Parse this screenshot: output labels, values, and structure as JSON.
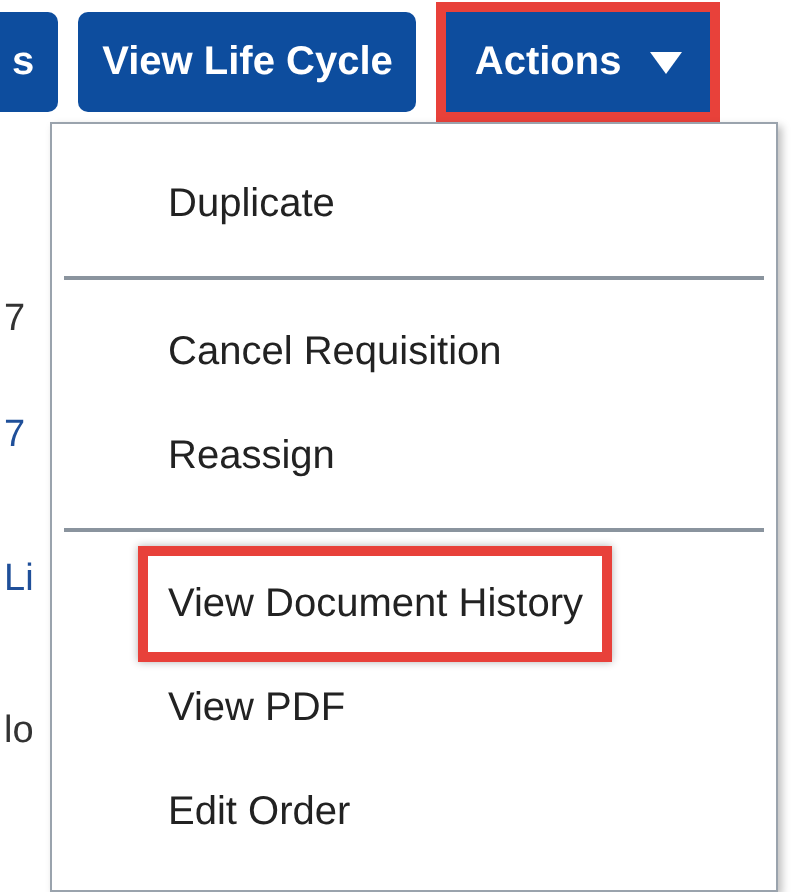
{
  "toolbar": [
    {
      "label": "s",
      "highlighted": false
    },
    {
      "label": "View Life Cycle",
      "highlighted": false
    },
    {
      "label": "Actions",
      "highlighted": true,
      "dropdown": true
    }
  ],
  "background_text": [
    {
      "text": "7",
      "link": false
    },
    {
      "text": "7",
      "link": true
    },
    {
      "text": "Li",
      "link": true
    },
    {
      "text": "lo",
      "link": false
    }
  ],
  "menu": {
    "groups": [
      [
        {
          "label": "Duplicate",
          "highlighted": false
        }
      ],
      [
        {
          "label": "Cancel Requisition",
          "highlighted": false
        },
        {
          "label": "Reassign",
          "highlighted": false
        }
      ],
      [
        {
          "label": "View Document History",
          "highlighted": true
        },
        {
          "label": "View PDF",
          "highlighted": false
        },
        {
          "label": "Edit Order",
          "highlighted": false
        }
      ]
    ]
  }
}
